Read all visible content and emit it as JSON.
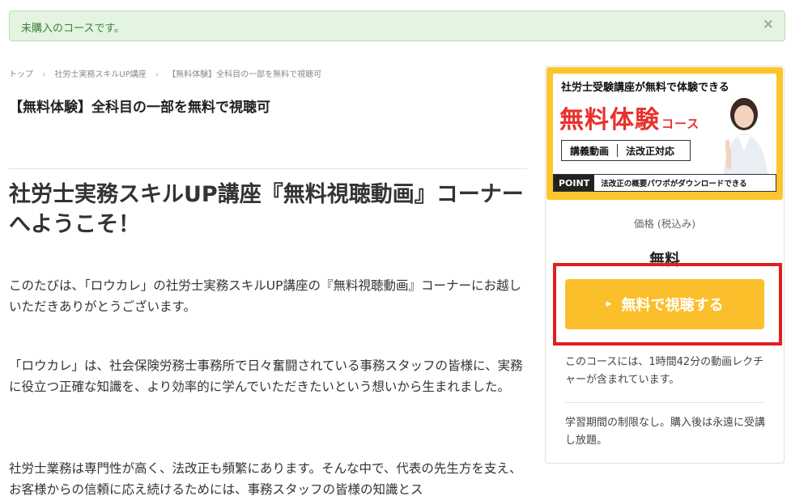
{
  "alert": {
    "text": "未購入のコースです。",
    "close": "×"
  },
  "breadcrumb": {
    "items": [
      "トップ",
      "社労士実務スキルUP講座",
      "【無料体験】全科目の一部を無料で視聴可"
    ],
    "sep": "›"
  },
  "course_title": "【無料体験】全科目の一部を無料で視聴可",
  "main": {
    "heading": "社労士実務スキルUP講座『無料視聴動画』コーナーへようこそ！",
    "paragraphs": [
      "このたびは、「ロウカレ」の社労士実務スキルUP講座の『無料視聴動画』コーナーにお越しいただきありがとうございます。",
      "「ロウカレ」は、社会保険労務士事務所で日々奮闘されている事務スタッフの皆様に、実務に役立つ正確な知識を、より効率的に学んでいただきたいという想いから生まれました。",
      "社労士業務は専門性が高く、法改正も頻繁にあります。そんな中で、代表の先生方を支え、お客様からの信頼に応え続けるためには、事務スタッフの皆様の知識とス"
    ]
  },
  "sidebar": {
    "banner": {
      "headline": "社労士受験講座が無料で体験できる",
      "big": "無料体験",
      "course": "コース",
      "tags": [
        "講義動画",
        "法改正対応"
      ],
      "point_label": "POINT",
      "point_text": "法改正の概要パワポがダウンロードできる"
    },
    "price_label": "価格 (税込み)",
    "price_value": "無料",
    "cta_label": "無料で視聴する",
    "info1": "このコースには、1時間42分の動画レクチャーが含まれています。",
    "info2": "学習期間の制限なし。購入後は永遠に受講し放題。"
  },
  "colors": {
    "accent": "#fbbf2c",
    "highlight": "#e01f1f",
    "alert_bg": "#e3f4e0"
  }
}
